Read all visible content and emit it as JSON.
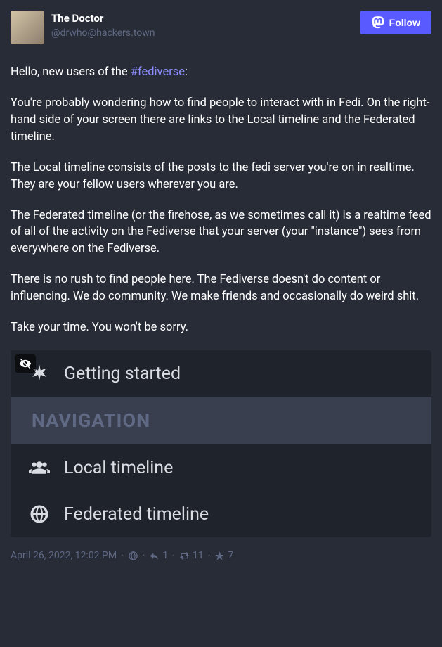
{
  "user": {
    "display_name": "The Doctor",
    "handle": "@drwho@hackers.town"
  },
  "follow_label": "Follow",
  "post": {
    "p1_pre": "Hello, new users of the ",
    "hashtag": "#fediverse",
    "p1_post": ":",
    "p2": "You're probably wondering how to find people to interact with in Fedi.  On the right-hand side of your screen there are links to the Local timeline and the Federated timeline.",
    "p3": "The Local timeline consists of the posts to the fedi server you're on in realtime.  They are your fellow users wherever you are.",
    "p4": "The Federated timeline (or the firehose, as we sometimes call it) is a realtime feed of all of the activity on the Fediverse that your server (your \"instance\") sees from everywhere on the Fediverse.",
    "p5": "There is no rush to find people here.  The Fediverse doesn't do content or influencing.  We do community.  We make friends and occasionally do weird shit.",
    "p6": "Take your time.  You won't be sorry."
  },
  "media": {
    "r1": "Getting started",
    "r2": "NAVIGATION",
    "r3": "Local timeline",
    "r4": "Federated timeline"
  },
  "meta": {
    "timestamp": "April 26, 2022, 12:02 PM",
    "replies": "1",
    "boosts": "11",
    "favs": "7"
  }
}
